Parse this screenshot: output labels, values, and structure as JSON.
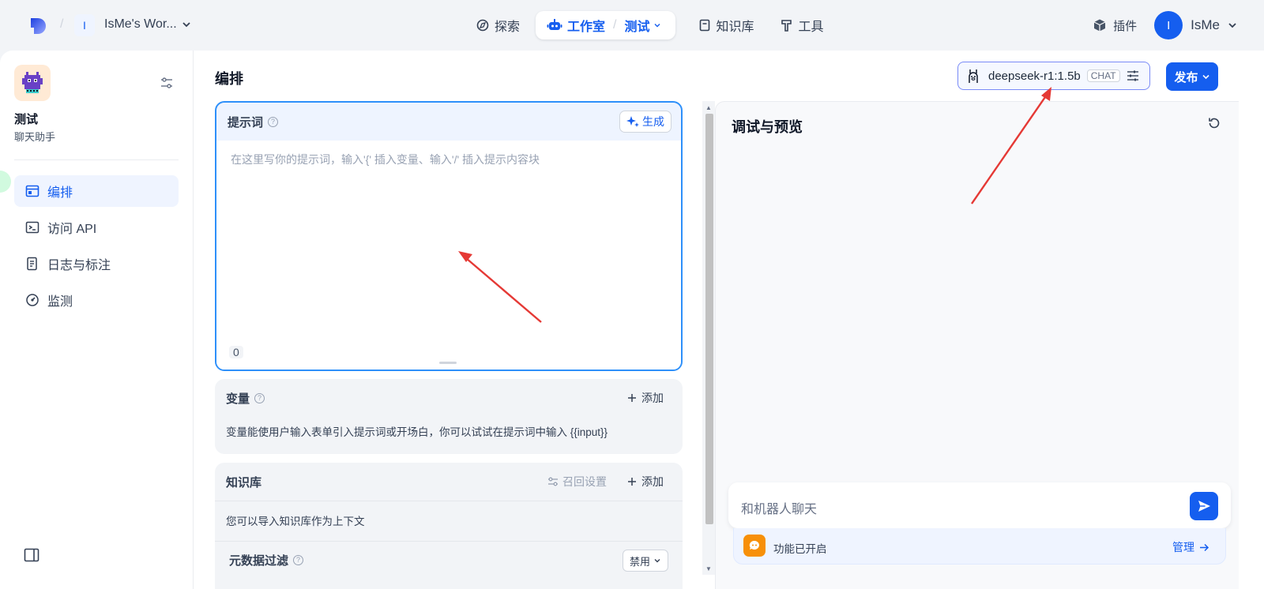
{
  "header": {
    "workspace_initial": "I",
    "workspace_name": "IsMe's Wor...",
    "nav": [
      {
        "label": "探索"
      },
      {
        "label": "工作室",
        "sub": "测试"
      },
      {
        "label": "知识库"
      },
      {
        "label": "工具"
      }
    ],
    "plugin_label": "插件",
    "user_initial": "I",
    "user_name": "IsMe"
  },
  "sidebar": {
    "app_name": "测试",
    "app_desc": "聊天助手",
    "items": [
      {
        "label": "编排",
        "icon": "layout-icon",
        "active": true
      },
      {
        "label": "访问 API",
        "icon": "terminal-icon"
      },
      {
        "label": "日志与标注",
        "icon": "file-list-icon"
      },
      {
        "label": "监测",
        "icon": "dashboard-icon"
      }
    ]
  },
  "main": {
    "title": "编排",
    "model": {
      "name": "deepseek-r1:1.5b",
      "tag": "CHAT"
    },
    "publish_label": "发布"
  },
  "prompt": {
    "title": "提示词",
    "generate_label": "生成",
    "placeholder": "在这里写你的提示词，输入'{' 插入变量、输入'/' 插入提示内容块",
    "char_count": "0"
  },
  "variables": {
    "title": "变量",
    "add_label": "添加",
    "description": "变量能使用户输入表单引入提示词或开场白，你可以试试在提示词中输入 {{input}}"
  },
  "knowledge": {
    "title": "知识库",
    "recall_label": "召回设置",
    "add_label": "添加",
    "description": "您可以导入知识库作为上下文",
    "filter_title": "元数据过滤",
    "filter_value": "禁用"
  },
  "preview": {
    "title": "调试与预览",
    "chat_placeholder": "和机器人聊天",
    "feature_text": "功能已开启",
    "manage_label": "管理"
  },
  "colors": {
    "accent": "#155eef",
    "annotation_arrow": "#e53935"
  }
}
